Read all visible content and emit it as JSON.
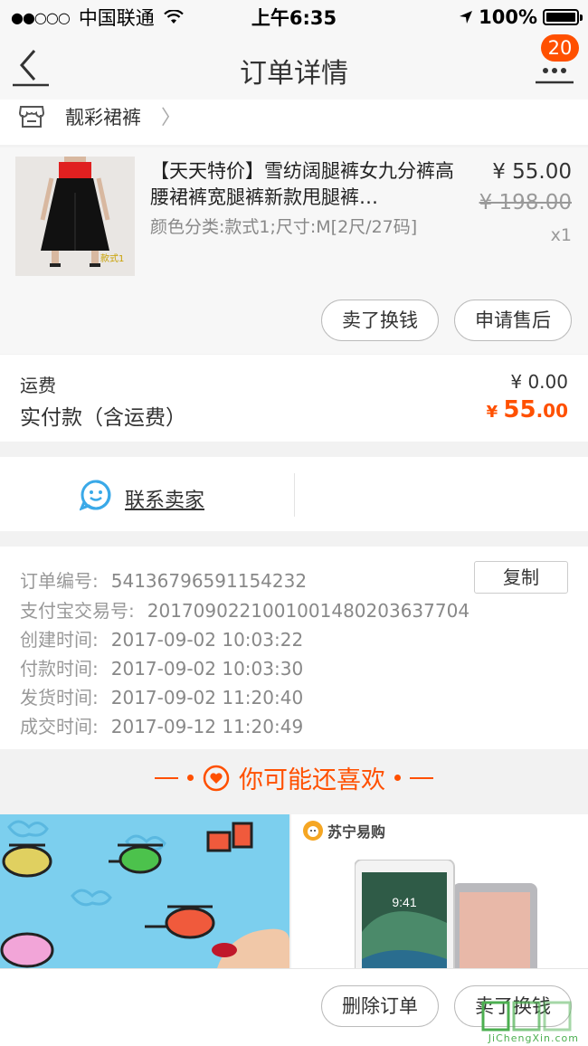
{
  "status_bar": {
    "carrier": "中国联通",
    "time": "上午6:35",
    "battery": "100%"
  },
  "nav": {
    "title": "订单详情",
    "badge_count": "20"
  },
  "shop": {
    "name": "靓彩裙裤"
  },
  "product": {
    "title": "【天天特价】雪纺阔腿裤女九分裤高腰裙裤宽腿裤新款甩腿裤…",
    "sku": "颜色分类:款式1;尺寸:M[2尺/27码]",
    "price_now": "¥ 55.00",
    "price_old": "¥ 198.00",
    "qty": "x1",
    "thumb_tag": "款式1",
    "btn_sell": "卖了换钱",
    "btn_after_sale": "申请售后"
  },
  "fees": {
    "shipping_label": "运费",
    "shipping_value": "¥ 0.00",
    "paid_label": "实付款（含运费）",
    "paid_yen": "¥ ",
    "paid_int": "55",
    "paid_dec": ".00"
  },
  "contact": {
    "label": "联系卖家"
  },
  "order_info": {
    "copy_label": "复制",
    "rows": [
      {
        "label": "订单编号:",
        "value": "54136796591154232"
      },
      {
        "label": "支付宝交易号:",
        "value": "2017090221001001480203637704"
      },
      {
        "label": "创建时间:",
        "value": "2017-09-02 10:03:22"
      },
      {
        "label": "付款时间:",
        "value": "2017-09-02 10:03:30"
      },
      {
        "label": "发货时间:",
        "value": "2017-09-02 11:20:40"
      },
      {
        "label": "成交时间:",
        "value": "2017-09-12 11:20:49"
      }
    ]
  },
  "recommend": {
    "title": "你可能还喜欢",
    "right_tile_brand": "苏宁易购",
    "ipad_time": "9:41"
  },
  "bottom": {
    "btn_delete": "删除订单",
    "btn_sell": "卖了换钱"
  },
  "watermark": {
    "text": "JiChengXin.com"
  },
  "colors": {
    "accent": "#ff5000",
    "badge": "#ff5000",
    "contact_icon": "#3aa9e8"
  }
}
